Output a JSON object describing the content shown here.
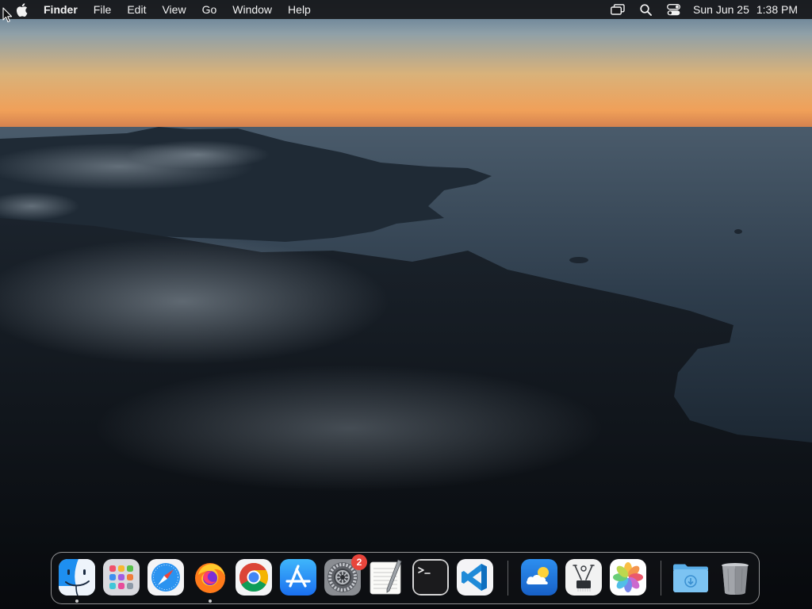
{
  "menubar": {
    "app_name": "Finder",
    "menus": [
      "File",
      "Edit",
      "View",
      "Go",
      "Window",
      "Help"
    ],
    "status_icons": [
      "screen-mirroring-icon",
      "spotlight-search-icon",
      "control-center-icon"
    ],
    "date": "Sun Jun 25",
    "time": "1:38 PM"
  },
  "dock": {
    "apps": [
      {
        "name": "Finder",
        "icon": "finder-icon",
        "running": true
      },
      {
        "name": "Launchpad",
        "icon": "launchpad-icon",
        "running": false
      },
      {
        "name": "Safari",
        "icon": "safari-icon",
        "running": false
      },
      {
        "name": "Firefox",
        "icon": "firefox-icon",
        "running": true
      },
      {
        "name": "Google Chrome",
        "icon": "chrome-icon",
        "running": false
      },
      {
        "name": "App Store",
        "icon": "app-store-icon",
        "running": false
      },
      {
        "name": "System Settings",
        "icon": "system-settings-icon",
        "running": false,
        "badge": "2"
      },
      {
        "name": "TextEdit",
        "icon": "textedit-icon",
        "running": false
      },
      {
        "name": "Terminal",
        "icon": "terminal-icon",
        "running": false
      },
      {
        "name": "Visual Studio Code",
        "icon": "vscode-icon",
        "running": false
      },
      {
        "name": "Weather",
        "icon": "weather-icon",
        "running": false
      },
      {
        "name": "System Information",
        "icon": "system-information-icon",
        "running": false
      },
      {
        "name": "Photos",
        "icon": "photos-icon",
        "running": false
      },
      {
        "name": "Downloads",
        "icon": "downloads-folder-icon",
        "running": false
      },
      {
        "name": "Trash",
        "icon": "trash-icon",
        "running": false
      }
    ]
  },
  "colors": {
    "menubar_bg": "#161618",
    "badge": "#e8453c",
    "sky_top": "#4f6f8c",
    "sky_horizon": "#f0a35a"
  }
}
